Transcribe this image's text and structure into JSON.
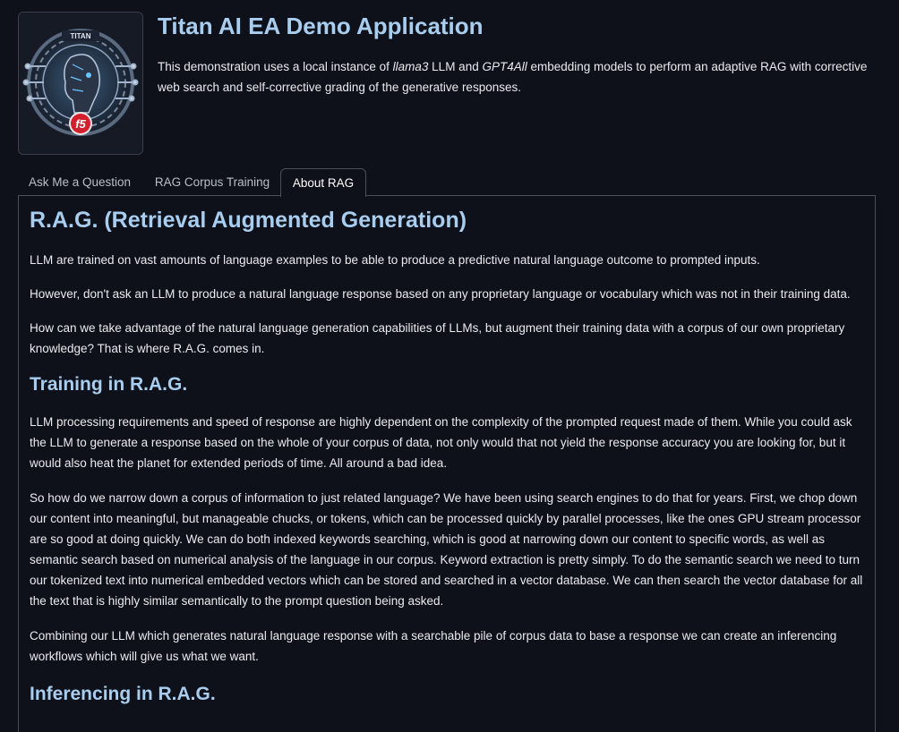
{
  "app": {
    "title": "Titan AI EA Demo Application",
    "logo_text": "TITAN",
    "logo_badge": "f5"
  },
  "intro": {
    "part1": "This demonstration uses a local instance of ",
    "llm_model": "llama3",
    "part2": " LLM and ",
    "embed_model": "GPT4All",
    "part3": " embedding models to perform an adaptive RAG with corrective web search and self-corrective grading of the generative responses."
  },
  "tabs": [
    {
      "label": "Ask Me a Question",
      "active": false
    },
    {
      "label": "RAG Corpus Training",
      "active": false
    },
    {
      "label": "About RAG",
      "active": true
    }
  ],
  "content": {
    "heading_main": "R.A.G. (Retrieval Augmented Generation)",
    "p1": "LLM are trained on vast amounts of language examples to be able to produce a predictive natural language outcome to prompted inputs.",
    "p2": "However, don't ask an LLM to produce a natural language response based on any proprietary language or vocabulary which was not in their training data.",
    "p3": "How can we take advantage of the natural language generation capabilities of LLMs, but augment their training data with a corpus of our own proprietary knowledge? That is where R.A.G. comes in.",
    "heading_training": "Training in R.A.G.",
    "p4": "LLM processing requirements and speed of response are highly dependent on the complexity of the prompted request made of them. While you could ask the LLM to generate a response based on the whole of your corpus of data, not only would that not yield the response accuracy you are looking for, but it would also heat the planet for extended periods of time. All around a bad idea.",
    "p5": "So how do we narrow down a corpus of information to just related language? We have been using search engines to do that for years. First, we chop down our content into meaningful, but manageable chucks, or tokens, which can be processed quickly by parallel processes, like the ones GPU stream processor are so good at doing quickly. We can do both indexed keywords searching, which is good at narrowing down our content to specific words, as well as semantic search based on numerical analysis of the language in our corpus. Keyword extraction is pretty simply. To do the semantic search we need to turn our tokenized text into numerical embedded vectors which can be stored and searched in a vector database. We can then search the vector database for all the text that is highly similar semantically to the prompt question being asked.",
    "p6": "Combining our LLM which generates natural language response with a searchable pile of corpus data to base a response we can create an inferencing workflows which will give us what we want.",
    "heading_inferencing": "Inferencing in R.A.G."
  },
  "colors": {
    "background": "#0e111a",
    "heading": "#a8cdee",
    "text": "#e9ebef",
    "border": "#4a4f5c"
  }
}
